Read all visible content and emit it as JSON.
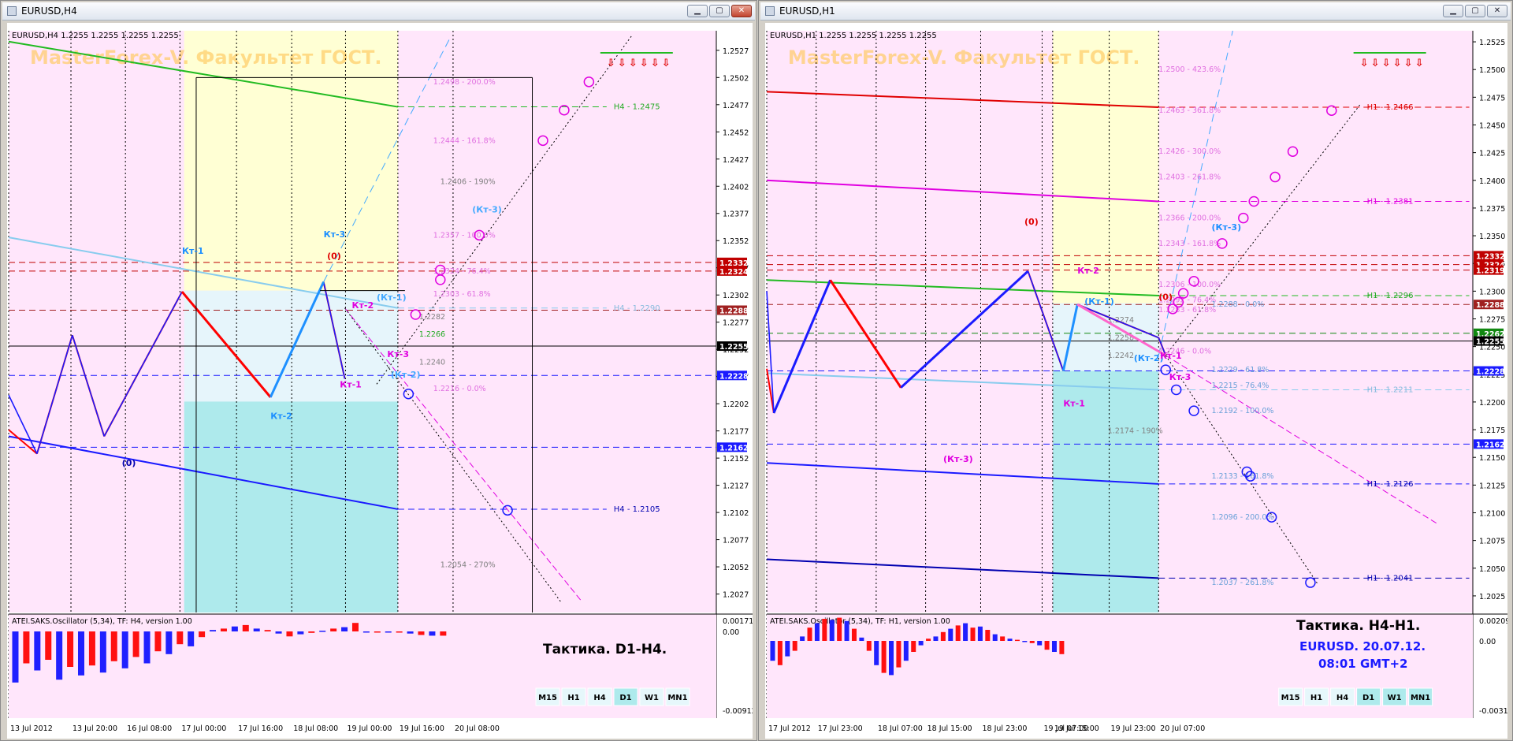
{
  "colors": {
    "bg": "#ffe6fb",
    "yellow": "#ffffd4",
    "cyan": "#aeeaec",
    "lightcyan": "#e6f5fb",
    "red": "#ff0000",
    "blue": "#1a1aff",
    "navy": "#0000b0",
    "green": "#22bb22",
    "magenta": "#e000e0",
    "skyblue": "#44aaff",
    "pinkfib": "#e070e0",
    "grayfib": "#808080",
    "watermark": "#ffcc66"
  },
  "watermark": "MasterForex-V. Факультет ГОСТ.",
  "left": {
    "window_title": "EURUSD,H4",
    "header": "EURUSD,H4  1.2255 1.2255 1.2255 1.2255",
    "osc_title": "ATEI.SAKS.Oscillator (5,34), TF: H4, version 1.00",
    "tactic": "Тактика. D1-H4.",
    "tf_buttons": [
      "M15",
      "H1",
      "H4",
      "D1",
      "W1",
      "MN1"
    ],
    "tf_active": [
      "D1"
    ],
    "price_min": 1.201,
    "price_max": 1.2545,
    "ticks": [
      "1.2527",
      "1.2502",
      "1.2477",
      "1.2452",
      "1.2427",
      "1.2402",
      "1.2377",
      "1.2352",
      "1.2327",
      "1.2302",
      "1.2277",
      "1.2252",
      "1.2227",
      "1.2202",
      "1.2177",
      "1.2152",
      "1.2127",
      "1.2102",
      "1.2077",
      "1.2052",
      "1.2027"
    ],
    "osc_ticks": [
      "0.00171",
      "0.00",
      "-0.00912"
    ],
    "time_labels": [
      "13 Jul 2012",
      "13 Jul 20:00",
      "16 Jul 08:00",
      "17 Jul 00:00",
      "17 Jul 16:00",
      "18 Jul 08:00",
      "19 Jul 00:00",
      "19 Jul 16:00",
      "20 Jul 08:00"
    ],
    "price_tags": [
      {
        "p": 1.2332,
        "t": "1.2332",
        "c": "#c00000"
      },
      {
        "p": 1.2324,
        "t": "1.2324",
        "c": "#c00000"
      },
      {
        "p": 1.2288,
        "t": "1.2288",
        "c": "#a02020"
      },
      {
        "p": 1.2255,
        "t": "1.2255",
        "c": "#000000"
      },
      {
        "p": 1.2228,
        "t": "1.2228",
        "c": "#1a1aff"
      },
      {
        "p": 1.2162,
        "t": "1.2162",
        "c": "#1a1aff"
      }
    ],
    "fib_labels": [
      {
        "p": 1.2498,
        "t": "1.2498 - 200.0%",
        "c": "#e070e0"
      },
      {
        "p": 1.2444,
        "t": "1.2444 - 161.8%",
        "c": "#e070e0"
      },
      {
        "p": 1.2406,
        "t": "1.2406 - 190%",
        "c": "#808080"
      },
      {
        "p": 1.2357,
        "t": "1.2357 - 100.0%",
        "c": "#e070e0"
      },
      {
        "p": 1.2324,
        "t": "1.2324 - 76.4%",
        "c": "#e070e0"
      },
      {
        "p": 1.2303,
        "t": "1.2303 - 61.8%",
        "c": "#e070e0"
      },
      {
        "p": 1.2282,
        "t": "1.2282",
        "c": "#808080"
      },
      {
        "p": 1.2266,
        "t": "1.2266",
        "c": "#22aa22"
      },
      {
        "p": 1.224,
        "t": "1.2240",
        "c": "#808080"
      },
      {
        "p": 1.2216,
        "t": "1.2216 - 0.0%",
        "c": "#e070e0"
      },
      {
        "p": 1.2054,
        "t": "1.2054 - 270%",
        "c": "#808080"
      }
    ],
    "level_labels": [
      {
        "p": 1.2475,
        "t": "H4 - 1.2475",
        "c": "#22aa22"
      },
      {
        "p": 1.229,
        "t": "H4 - 1.2290",
        "c": "#88bbdd"
      },
      {
        "p": 1.2105,
        "t": "H4 - 1.2105",
        "c": "#0000b0"
      }
    ],
    "point_labels": [
      {
        "t": "Кт-1",
        "x": 0.245,
        "p": 1.234,
        "c": "#1e90ff"
      },
      {
        "t": "Кт-3",
        "x": 0.445,
        "p": 1.2355,
        "c": "#1e90ff"
      },
      {
        "t": "(0)",
        "x": 0.45,
        "p": 1.2335,
        "c": "#e00000"
      },
      {
        "t": "(Кт-3)",
        "x": 0.655,
        "p": 1.2378,
        "c": "#44aaff"
      },
      {
        "t": "(Кт-1)",
        "x": 0.52,
        "p": 1.2297,
        "c": "#44aaff"
      },
      {
        "t": "Кт-2",
        "x": 0.485,
        "p": 1.229,
        "c": "#e000e0"
      },
      {
        "t": "Кт-2",
        "x": 0.37,
        "p": 1.2188,
        "c": "#1e90ff"
      },
      {
        "t": "Кт-1",
        "x": 0.468,
        "p": 1.2217,
        "c": "#e000e0"
      },
      {
        "t": "Кт-3",
        "x": 0.535,
        "p": 1.2245,
        "c": "#e000e0"
      },
      {
        "t": "(Кт-2)",
        "x": 0.54,
        "p": 1.2226,
        "c": "#44aaff"
      },
      {
        "t": "(0)",
        "x": 0.16,
        "p": 1.2145,
        "c": "#0000b0"
      }
    ]
  },
  "right": {
    "window_title": "EURUSD,H1",
    "header": "EURUSD,H1  1.2255 1.2255 1.2255 1.2255",
    "osc_title": "ATEI.SAKS.Oscillator (5,34), TF: H1, version 1.00",
    "tactic": "Тактика. H4-H1.",
    "subline1": "EURUSD. 20.07.12.",
    "subline2": "08:01  GMT+2",
    "tf_buttons": [
      "M15",
      "H1",
      "H4",
      "D1",
      "W1",
      "MN1"
    ],
    "tf_active": [
      "D1",
      "W1",
      "MN1"
    ],
    "price_min": 1.201,
    "price_max": 1.2535,
    "ticks": [
      "1.2525",
      "1.2500",
      "1.2475",
      "1.2450",
      "1.2425",
      "1.2400",
      "1.2375",
      "1.2350",
      "1.2325",
      "1.2300",
      "1.2275",
      "1.2250",
      "1.2225",
      "1.2200",
      "1.2175",
      "1.2150",
      "1.2125",
      "1.2100",
      "1.2075",
      "1.2050",
      "1.2025"
    ],
    "osc_ticks": [
      "0.00209",
      "0.00",
      "-0.00316"
    ],
    "time_labels": [
      "17 Jul 2012",
      "17 Jul 23:00",
      "18 Jul 07:00",
      "18 Jul 15:00",
      "18 Jul 23:00",
      "19 Jul 07:00",
      "19 Jul 15:00",
      "19 Jul 23:00",
      "20 Jul 07:00"
    ],
    "price_tags": [
      {
        "p": 1.2332,
        "t": "1.2332",
        "c": "#c00000"
      },
      {
        "p": 1.2324,
        "t": "1.2324",
        "c": "#c00000"
      },
      {
        "p": 1.2319,
        "t": "1.2319",
        "c": "#c00000"
      },
      {
        "p": 1.2288,
        "t": "1.2288",
        "c": "#a02020"
      },
      {
        "p": 1.2262,
        "t": "1.2262",
        "c": "#118811"
      },
      {
        "p": 1.2255,
        "t": "1.2255",
        "c": "#000000"
      },
      {
        "p": 1.2228,
        "t": "1.2228",
        "c": "#1a1aff"
      },
      {
        "p": 1.2162,
        "t": "1.2162",
        "c": "#1a1aff"
      }
    ],
    "fib_labels": [
      {
        "p": 1.25,
        "t": "1.2500 - 423.6%",
        "c": "#e070e0"
      },
      {
        "p": 1.2463,
        "t": "1.2463 - 361.8%",
        "c": "#e070e0"
      },
      {
        "p": 1.2426,
        "t": "1.2426 - 300.0%",
        "c": "#e070e0"
      },
      {
        "p": 1.2403,
        "t": "1.2403 - 261.8%",
        "c": "#e070e0"
      },
      {
        "p": 1.2366,
        "t": "1.2366 - 200.0%",
        "c": "#e070e0"
      },
      {
        "p": 1.2343,
        "t": "1.2343 - 161.8%",
        "c": "#e070e0"
      },
      {
        "p": 1.2306,
        "t": "1.2306 - 100.0%",
        "c": "#e070e0"
      },
      {
        "p": 1.2292,
        "t": "1.2292 - 76.4%",
        "c": "#e070e0"
      },
      {
        "p": 1.2283,
        "t": "1.2283 - 61.8%",
        "c": "#e070e0"
      },
      {
        "p": 1.2246,
        "t": "1.2246 - 0.0%",
        "c": "#e070e0"
      },
      {
        "p": 1.2274,
        "t": "1.2274",
        "c": "#808080"
      },
      {
        "p": 1.2258,
        "t": "1.2258",
        "c": "#808080"
      },
      {
        "p": 1.2242,
        "t": "1.2242",
        "c": "#808080"
      },
      {
        "p": 1.2174,
        "t": "1.2174 - 190%",
        "c": "#808080"
      },
      {
        "p": 1.2288,
        "t": "1.2288 - 0.0%",
        "c": "#6aa0d8"
      },
      {
        "p": 1.2229,
        "t": "1.2229 - 61.8%",
        "c": "#6aa0d8"
      },
      {
        "p": 1.2215,
        "t": "1.2215 - 76.4%",
        "c": "#6aa0d8"
      },
      {
        "p": 1.2192,
        "t": "1.2192 - 100.0%",
        "c": "#6aa0d8"
      },
      {
        "p": 1.2133,
        "t": "1.2133 - 161.8%",
        "c": "#6aa0d8"
      },
      {
        "p": 1.2096,
        "t": "1.2096 - 200.0%",
        "c": "#6aa0d8"
      },
      {
        "p": 1.2037,
        "t": "1.2037 - 261.8%",
        "c": "#6aa0d8"
      }
    ],
    "level_labels": [
      {
        "p": 1.2466,
        "t": "H1 - 1.2466",
        "c": "#e00000"
      },
      {
        "p": 1.2381,
        "t": "H1 - 1.2381",
        "c": "#e000e0"
      },
      {
        "p": 1.2296,
        "t": "H1 - 1.2296",
        "c": "#22aa22"
      },
      {
        "p": 1.2211,
        "t": "H1 - 1.2211",
        "c": "#88bbdd"
      },
      {
        "p": 1.2126,
        "t": "H1 - 1.2126",
        "c": "#0000b0"
      },
      {
        "p": 1.2041,
        "t": "H1 - 1.2041",
        "c": "#0000b0"
      }
    ],
    "point_labels": [
      {
        "t": "(0)",
        "x": 0.365,
        "p": 1.236,
        "c": "#e00000"
      },
      {
        "t": "Кт-2",
        "x": 0.44,
        "p": 1.2316,
        "c": "#e000e0"
      },
      {
        "t": "(Кт-3)",
        "x": 0.63,
        "p": 1.2355,
        "c": "#1e90ff"
      },
      {
        "t": "(Кт-1)",
        "x": 0.45,
        "p": 1.2288,
        "c": "#1e90ff"
      },
      {
        "t": "(0)",
        "x": 0.555,
        "p": 1.2292,
        "c": "#e00000"
      },
      {
        "t": "(Кт-2)",
        "x": 0.52,
        "p": 1.2237,
        "c": "#1e90ff"
      },
      {
        "t": "Кт-3",
        "x": 0.57,
        "p": 1.222,
        "c": "#e000e0"
      },
      {
        "t": "Кт-1",
        "x": 0.42,
        "p": 1.2196,
        "c": "#e000e0"
      },
      {
        "t": "Кт-1",
        "x": 0.557,
        "p": 1.2239,
        "c": "#e000e0"
      },
      {
        "t": "(Кт-3)",
        "x": 0.25,
        "p": 1.2146,
        "c": "#e000e0"
      }
    ]
  },
  "chart_data": [
    {
      "type": "line",
      "title": "EURUSD,H4",
      "series": [
        {
          "kind": "zigzag",
          "color": "#ff0000",
          "points": [
            [
              0.0,
              1.2178
            ],
            [
              0.04,
              1.2156
            ],
            [
              0.09,
              1.2265
            ],
            [
              0.135,
              1.2172
            ],
            [
              0.245,
              1.2305
            ],
            [
              0.37,
              1.2208
            ],
            [
              0.445,
              1.2314
            ],
            [
              0.475,
              1.2225
            ]
          ]
        },
        {
          "kind": "zigzag",
          "color": "#1a1aff",
          "points": [
            [
              0.0,
              1.221
            ],
            [
              0.04,
              1.2156
            ],
            [
              0.09,
              1.2265
            ],
            [
              0.135,
              1.2172
            ],
            [
              0.245,
              1.2305
            ],
            [
              0.37,
              1.2208
            ],
            [
              0.445,
              1.2314
            ],
            [
              0.475,
              1.2225
            ]
          ]
        }
      ],
      "osc": [
        -0.0072,
        -0.0045,
        -0.0055,
        -0.004,
        -0.0068,
        -0.005,
        -0.0062,
        -0.0048,
        -0.0058,
        -0.0042,
        -0.0052,
        -0.0036,
        -0.0045,
        -0.0028,
        -0.0032,
        -0.0018,
        -0.0021,
        -0.0008,
        0.0002,
        0.0004,
        0.0007,
        0.0009,
        0.0004,
        0.0002,
        -0.0003,
        -0.0007,
        -0.0004,
        -0.0002,
        0.0001,
        0.0004,
        0.0006,
        0.0012,
        -0.0001,
        -0.0001,
        -0.0001,
        -0.0001,
        -0.0003,
        -0.0005,
        -0.0006,
        -0.0006
      ]
    },
    {
      "type": "line",
      "title": "EURUSD,H1",
      "series": [
        {
          "kind": "zigzag",
          "color": "#ff0000",
          "points": [
            [
              0.0,
              1.223
            ],
            [
              0.01,
              1.219
            ],
            [
              0.09,
              1.231
            ],
            [
              0.19,
              1.2213
            ],
            [
              0.37,
              1.2318
            ],
            [
              0.42,
              1.2228
            ],
            [
              0.44,
              1.2288
            ],
            [
              0.555,
              1.2258
            ],
            [
              0.565,
              1.2242
            ]
          ]
        },
        {
          "kind": "zigzag",
          "color": "#1a1aff",
          "points": [
            [
              0.0,
              1.23
            ],
            [
              0.01,
              1.219
            ],
            [
              0.09,
              1.231
            ],
            [
              0.19,
              1.2213
            ],
            [
              0.37,
              1.2318
            ],
            [
              0.42,
              1.2228
            ],
            [
              0.44,
              1.2288
            ],
            [
              0.555,
              1.2258
            ],
            [
              0.565,
              1.2242
            ]
          ]
        }
      ],
      "osc": [
        -0.0018,
        -0.0022,
        -0.0014,
        -0.0009,
        0.0004,
        0.0012,
        0.0016,
        0.002,
        0.0019,
        0.0021,
        0.0018,
        0.0011,
        0.0003,
        -0.0009,
        -0.0022,
        -0.0029,
        -0.0031,
        -0.0024,
        -0.0018,
        -0.001,
        -0.0004,
        0.0002,
        0.0004,
        0.0008,
        0.0011,
        0.0014,
        0.0016,
        0.0012,
        0.0013,
        0.001,
        0.0006,
        0.0004,
        0.0002,
        0.0001,
        -0.0001,
        -0.0002,
        -0.0004,
        -0.0008,
        -0.001,
        -0.0012
      ]
    }
  ]
}
